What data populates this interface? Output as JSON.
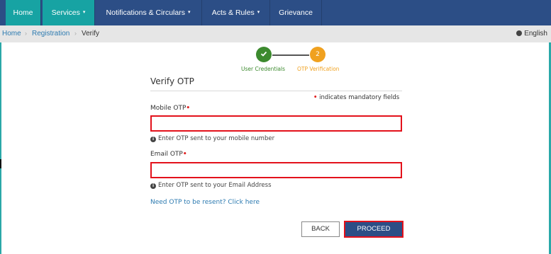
{
  "nav": {
    "home": "Home",
    "services": "Services",
    "notifications": "Notifications & Circulars",
    "acts": "Acts & Rules",
    "grievance": "Grievance",
    "caret": "▾"
  },
  "breadcrumb": {
    "home": "Home",
    "registration": "Registration",
    "verify": "Verify",
    "separator": "›"
  },
  "language": "English",
  "stepper": {
    "step1_label": "User Credentials",
    "step2_label": "OTP Verification",
    "step1_icon": "checkmark-icon",
    "step2_number": "2"
  },
  "form": {
    "title": "Verify OTP",
    "mandatory_note": "indicates mandatory fields",
    "required_mark": "•",
    "mobile_label": "Mobile OTP",
    "mobile_value": "",
    "mobile_help": "Enter OTP sent to your mobile number",
    "email_label": "Email OTP",
    "email_value": "",
    "email_help": "Enter OTP sent to your Email Address",
    "resend_link": "Need OTP to be resent? Click here",
    "back_label": "BACK",
    "proceed_label": "PROCEED"
  },
  "colors": {
    "nav_bg": "#2c4e86",
    "nav_active": "#17a3a3",
    "step_done": "#3c8a2e",
    "step_current": "#f0a11f",
    "error_border": "#e3111b",
    "link": "#2c7ab0"
  }
}
